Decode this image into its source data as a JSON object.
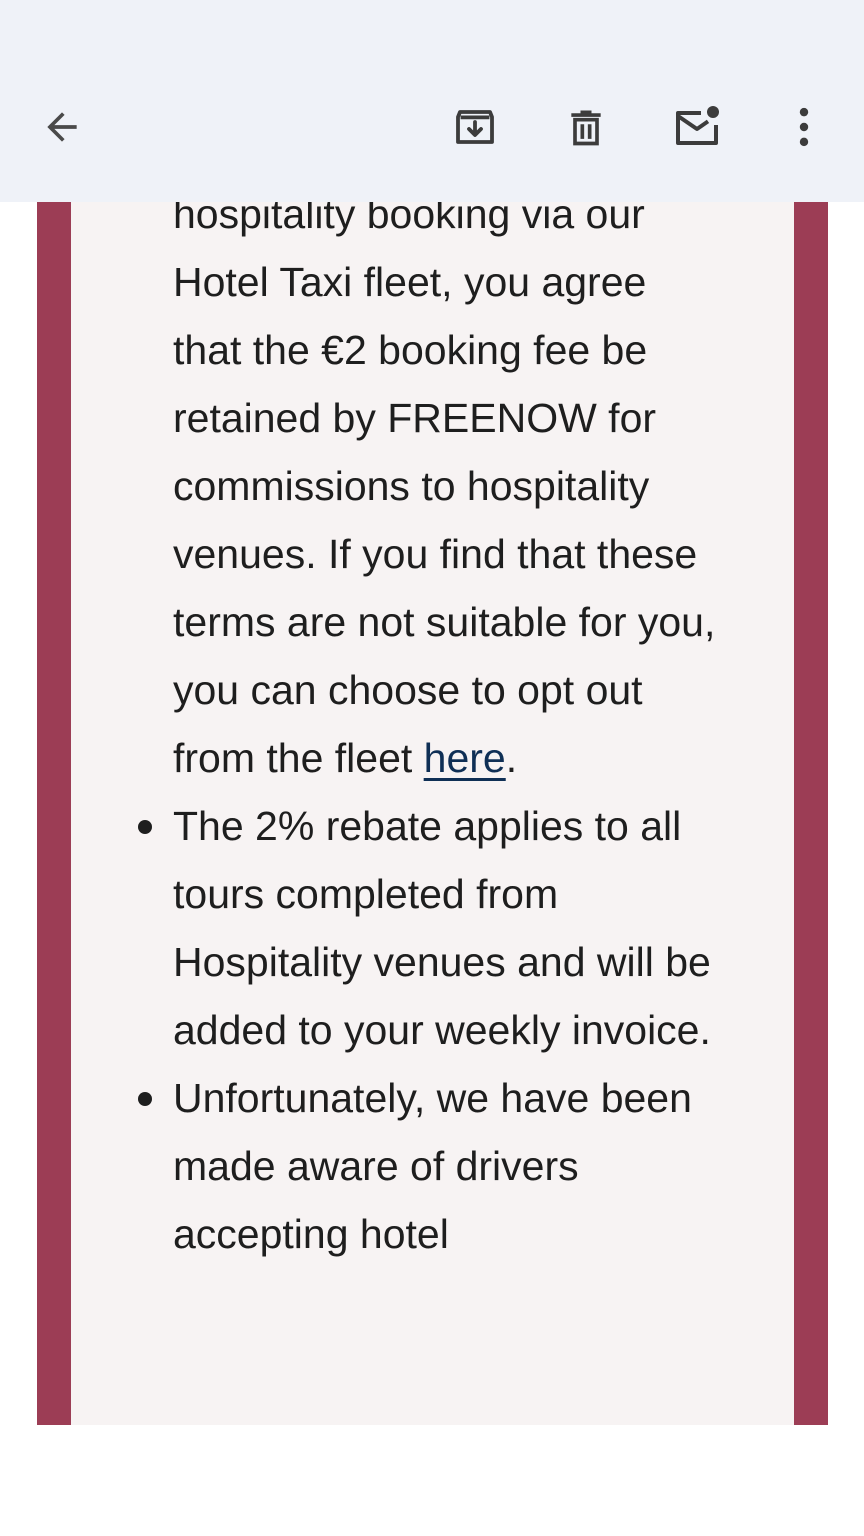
{
  "toolbar": {
    "back_icon": "arrow-back-icon",
    "archive_icon": "archive-icon",
    "delete_icon": "trash-icon",
    "mark_unread_icon": "mark-unread-icon",
    "more_icon": "more-vertical-icon"
  },
  "colors": {
    "toolbar_bg": "#eff2f8",
    "frame_accent": "#9c3d55",
    "panel_bg": "#f7f3f3",
    "link": "#0f2f55"
  },
  "email": {
    "items": [
      {
        "text": "hospitality booking via our Hotel Taxi fleet, you agree that the €2 booking fee be retained by FREENOW for commissions to hospitality venues. If you find that these terms are not suitable for you, you can choose to opt out from the fleet ",
        "link": "here",
        "after": "."
      },
      {
        "text": "The 2% rebate applies to all tours completed from Hospitality venues and will be added to your weekly invoice."
      },
      {
        "text": "Unfortunately, we have been made aware of drivers accepting hotel"
      }
    ]
  }
}
